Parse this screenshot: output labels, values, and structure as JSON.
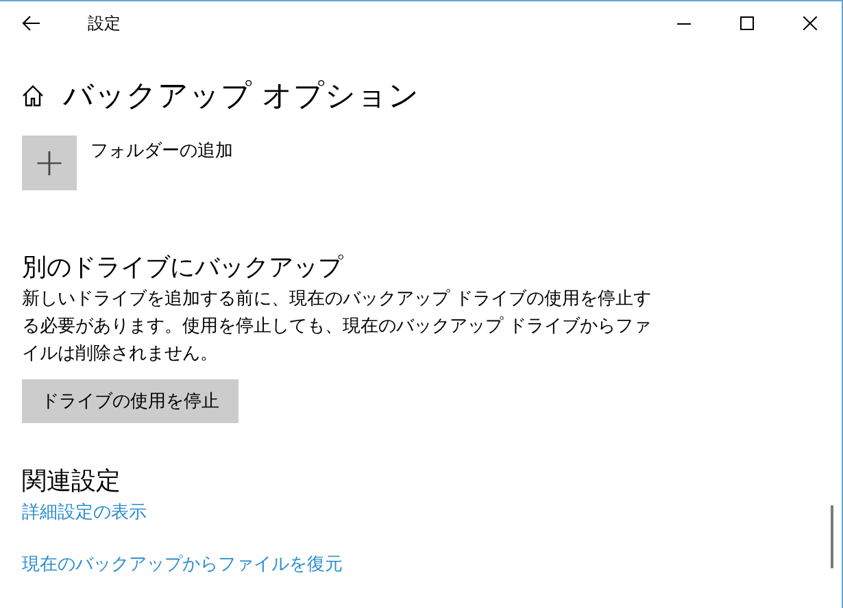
{
  "window": {
    "title": "設定"
  },
  "page": {
    "title": "バックアップ オプション"
  },
  "add_folder": {
    "icon": "+",
    "label": "フォルダーの追加"
  },
  "other_drive": {
    "heading": "別のドライブにバックアップ",
    "description": "新しいドライブを追加する前に、現在のバックアップ ドライブの使用を停止する必要があります。使用を停止しても、現在のバックアップ ドライブからファイルは削除されません。",
    "button": "ドライブの使用を停止"
  },
  "related": {
    "heading": "関連設定",
    "links": [
      "詳細設定の表示",
      "現在のバックアップからファイルを復元"
    ]
  }
}
